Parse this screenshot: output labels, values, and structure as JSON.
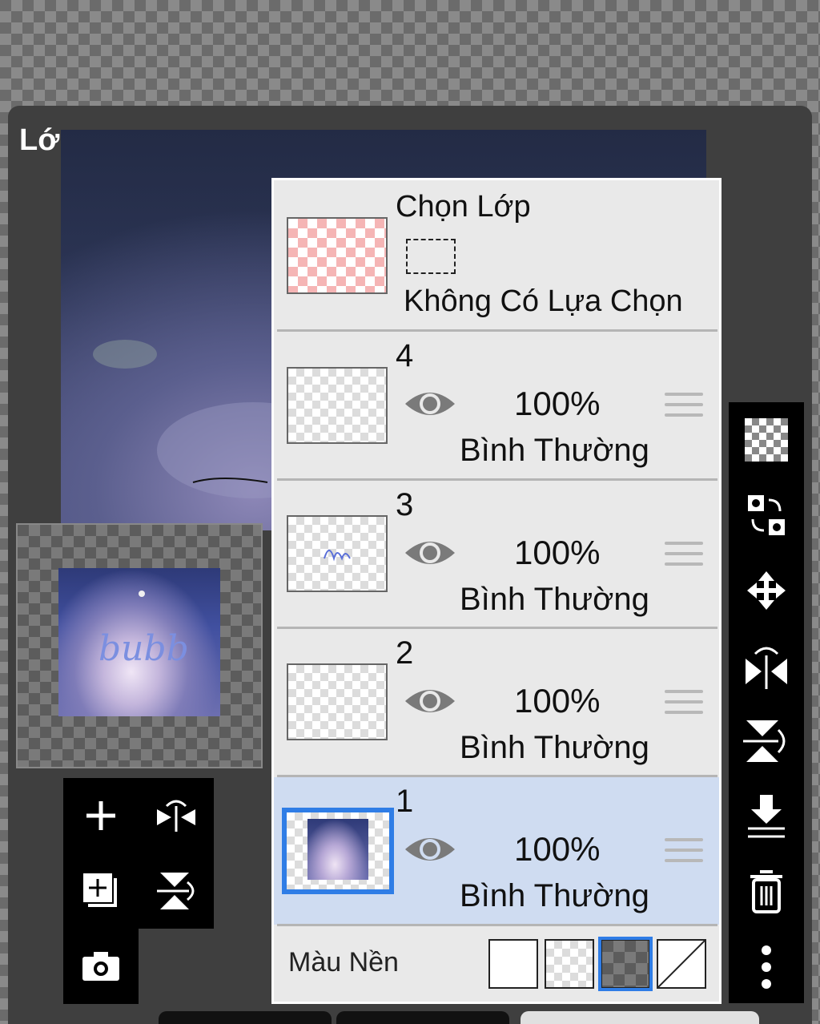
{
  "panel": {
    "title": "Lớp"
  },
  "selection": {
    "title": "Chọn Lớp",
    "status": "Không Có Lựa Chọn"
  },
  "layers": [
    {
      "number": "4",
      "opacity": "100%",
      "blend_mode": "Bình Thường",
      "visible": true,
      "selected": false
    },
    {
      "number": "3",
      "opacity": "100%",
      "blend_mode": "Bình Thường",
      "visible": true,
      "selected": false
    },
    {
      "number": "2",
      "opacity": "100%",
      "blend_mode": "Bình Thường",
      "visible": true,
      "selected": false
    },
    {
      "number": "1",
      "opacity": "100%",
      "blend_mode": "Bình Thường",
      "visible": true,
      "selected": true
    }
  ],
  "background": {
    "label": "Màu Nền",
    "options": [
      "white",
      "transparent-light",
      "transparent-dark",
      "none"
    ],
    "selected": "transparent-dark"
  },
  "preview": {
    "watermark_text": "bubb"
  },
  "left_toolbar": [
    "add-layer",
    "rotate-flip-horizontal",
    "add-layer-copy",
    "rotate-flip-vertical",
    "camera"
  ],
  "right_toolbar": [
    "transparency",
    "swap-layers",
    "move",
    "flip-horizontal",
    "flip-vertical",
    "merge-down",
    "delete",
    "more"
  ],
  "colors": {
    "selected_row": "#cfdcf1",
    "accent": "#2f7de6",
    "panel_bg": "#e9e9e9"
  }
}
